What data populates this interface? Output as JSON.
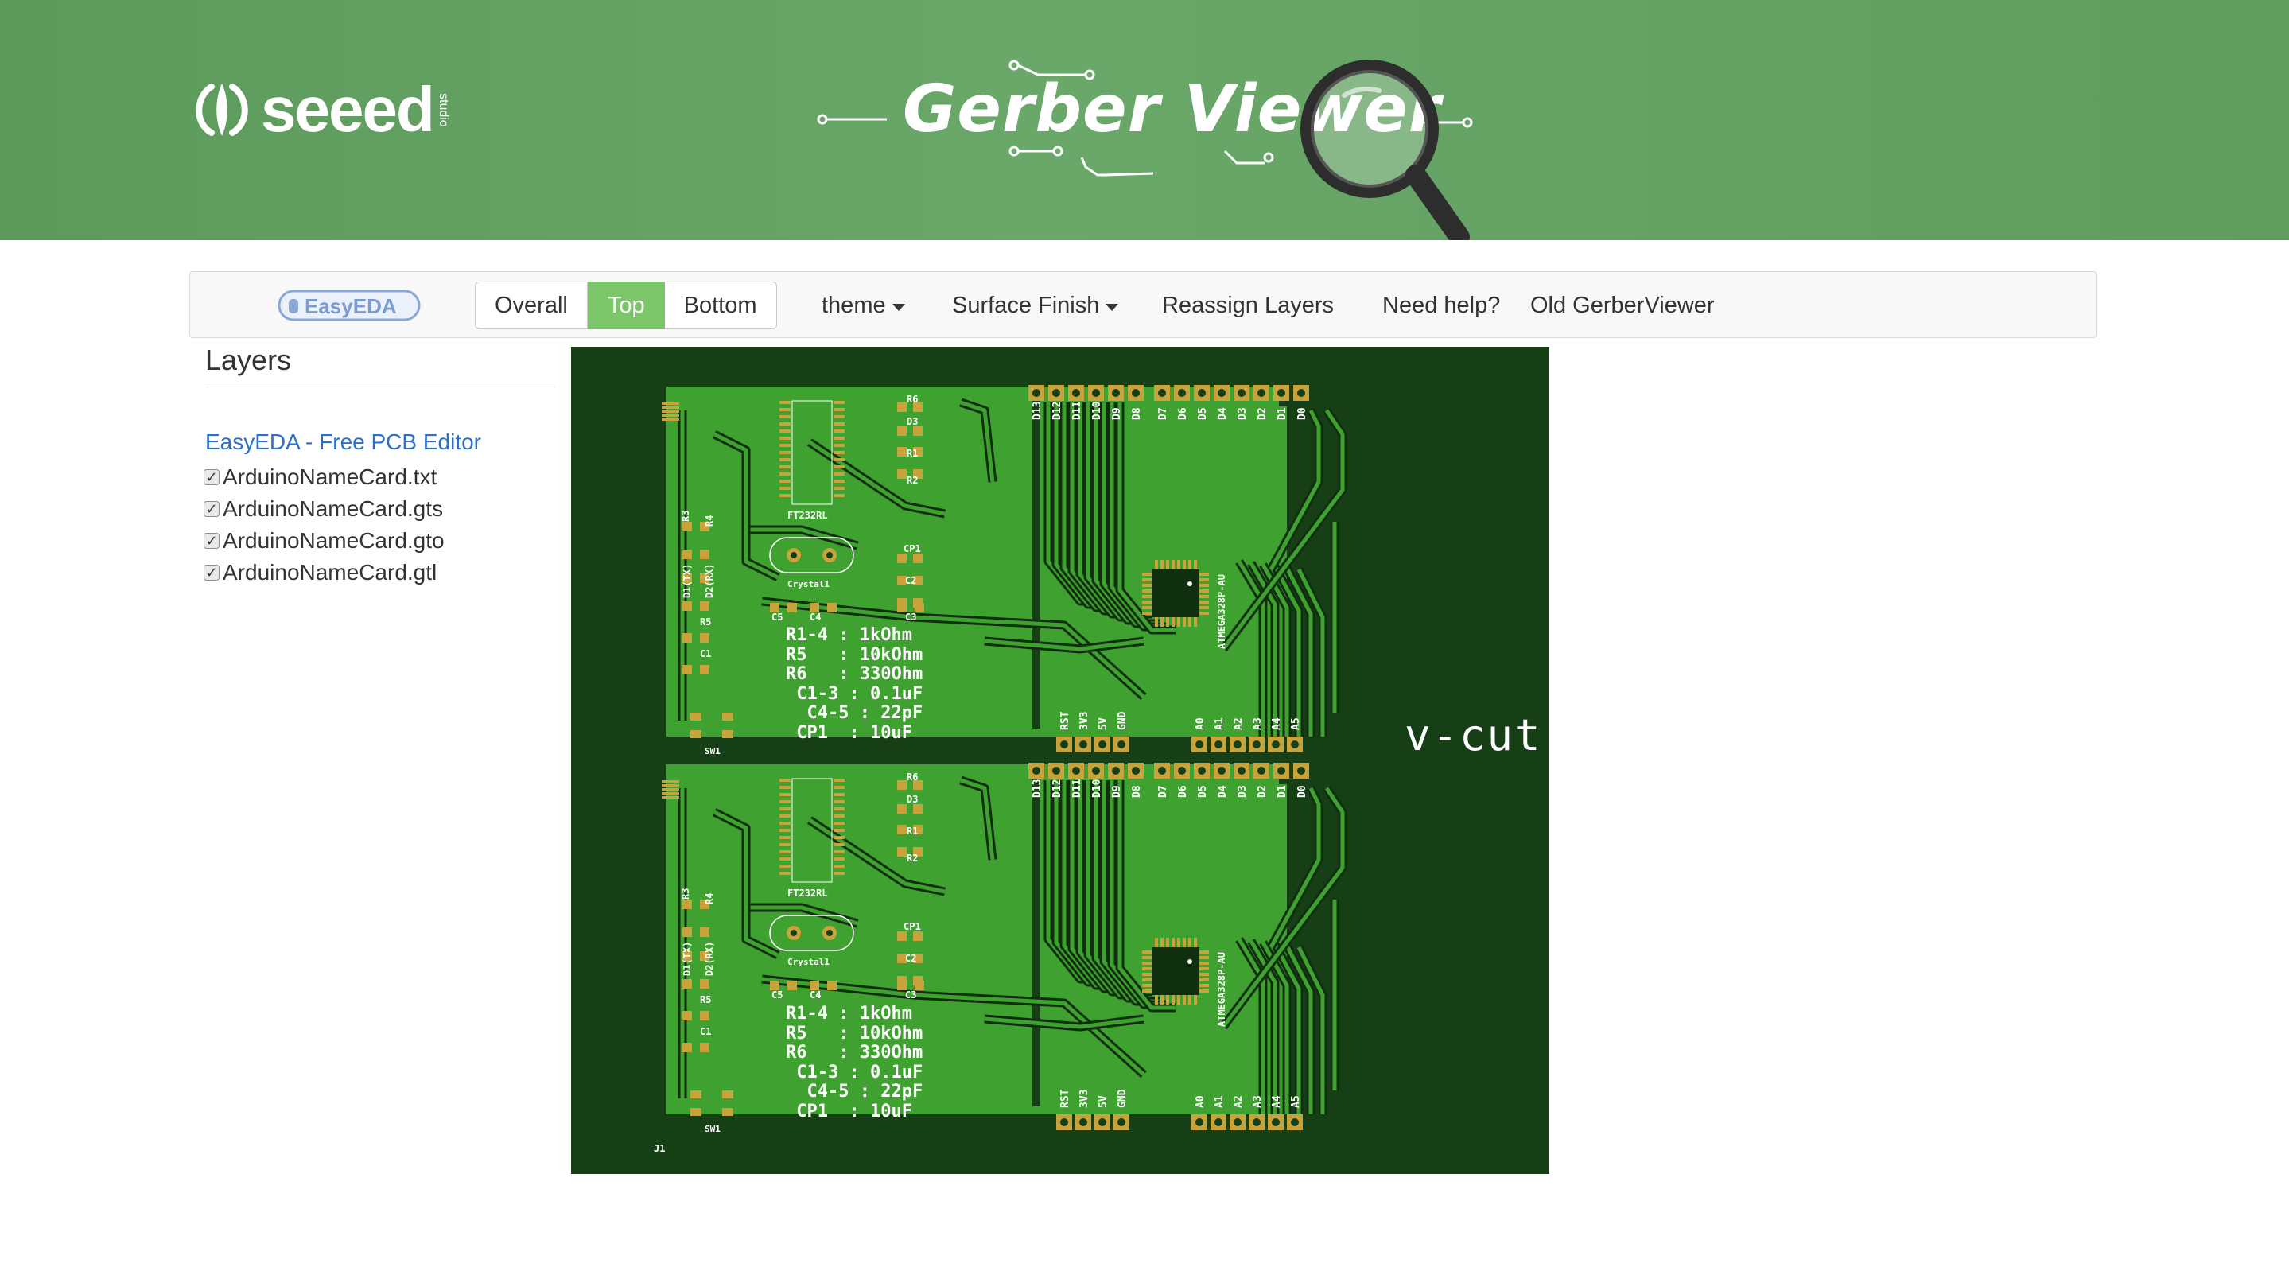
{
  "header": {
    "logo_text": "seeed",
    "logo_sub": "studio",
    "title": "Gerber Viewer"
  },
  "navbar": {
    "easyeda_logo": "EasyEDA",
    "view_buttons": [
      "Overall",
      "Top",
      "Bottom"
    ],
    "active_view": "Top",
    "theme": "theme",
    "surface_finish": "Surface Finish",
    "reassign_layers": "Reassign Layers",
    "need_help": "Need help?",
    "old_viewer": "Old GerberViewer"
  },
  "layers": {
    "title": "Layers",
    "link": "EasyEDA - Free PCB Editor",
    "files": [
      {
        "name": "ArduinoNameCard.txt",
        "checked": true
      },
      {
        "name": "ArduinoNameCard.gts",
        "checked": true
      },
      {
        "name": "ArduinoNameCard.gto",
        "checked": true
      },
      {
        "name": "ArduinoNameCard.gtl",
        "checked": true
      }
    ]
  },
  "pcb": {
    "vcut_label": "v-cut",
    "notes": "R1-4 : 1kOhm\nR5   : 10kOhm\nR6   : 330Ohm\n C1-3 : 0.1uF\n  C4-5 : 22pF\n CP1  : 10uF",
    "top_header_labels": [
      "D13",
      "D12",
      "D11",
      "D10",
      "D9",
      "D8",
      "D7",
      "D6",
      "D5",
      "D4",
      "D3",
      "D2",
      "D1",
      "D0"
    ],
    "bottom_header_left": [
      "RST",
      "3V3",
      "5V",
      "GND"
    ],
    "bottom_header_right": [
      "A0",
      "A1",
      "A2",
      "A3",
      "A4",
      "A5"
    ],
    "chip_label": "ATMEGA328P-AU",
    "ft_label": "FT232RL",
    "crystal_label": "Crystal1",
    "refs": [
      "R6",
      "D3",
      "R1",
      "R2",
      "CP1",
      "C2",
      "C3",
      "C5",
      "C4",
      "R3",
      "R4",
      "R5",
      "C1",
      "D1(TX)",
      "D2(RX)",
      "SW1",
      "J1"
    ],
    "colors": {
      "board": "#163f16",
      "copper": "#3fa12f",
      "pad": "#c8a23a",
      "silk": "#ffffff"
    }
  }
}
